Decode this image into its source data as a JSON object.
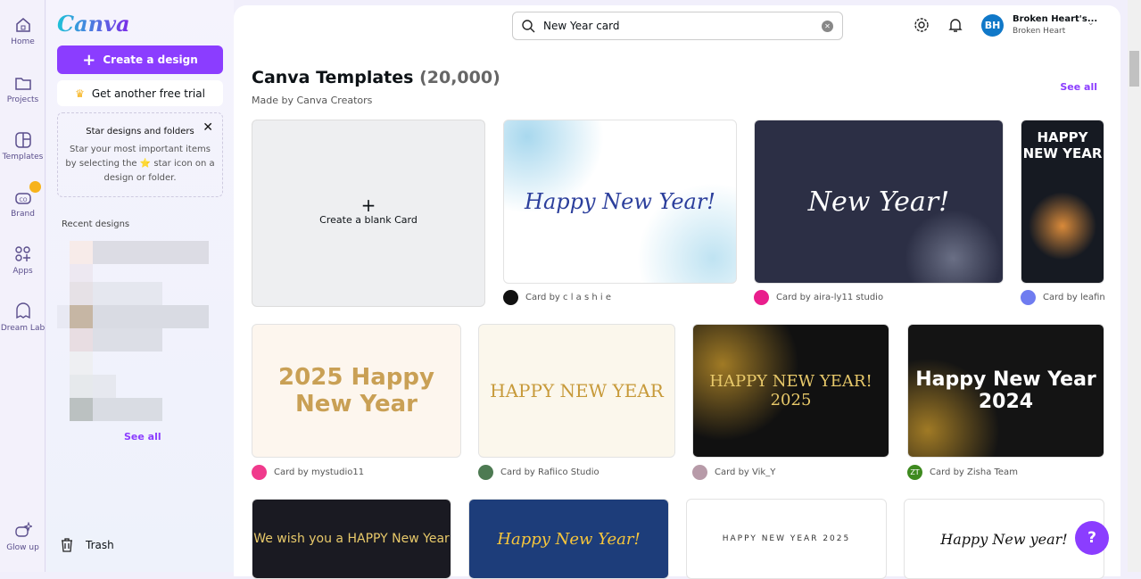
{
  "rail": [
    {
      "label": "Home",
      "icon": "home-icon"
    },
    {
      "label": "Projects",
      "icon": "folder-icon"
    },
    {
      "label": "Templates",
      "icon": "templates-icon"
    },
    {
      "label": "Brand",
      "icon": "brand-icon"
    },
    {
      "label": "Apps",
      "icon": "apps-icon"
    },
    {
      "label": "Dream Lab",
      "icon": "dream-lab-icon"
    },
    {
      "label": "Glow up",
      "icon": "glow-up-icon"
    }
  ],
  "sidebar": {
    "logo": "Canva",
    "create": "Create a design",
    "trial": "Get another free trial",
    "tip_title": "Star designs and folders",
    "tip_body": "Star your most important items by selecting the ⭐ star icon on a design or folder.",
    "recent": "Recent designs",
    "see_all": "See all",
    "trash": "Trash"
  },
  "header": {
    "search_value": "New Year card",
    "user_name": "Broken Heart's...",
    "user_sub": "Broken Heart",
    "avatar": "BH"
  },
  "main": {
    "title": "Canva Templates",
    "count": "(20,000)",
    "subtitle": "Made by Canva Creators",
    "see_all": "See all",
    "blank": "Create a blank Card",
    "cards": [
      {
        "thumb": "Happy New Year!",
        "by": "Card by c l a s h i e",
        "color": "#111"
      },
      {
        "thumb": "New Year!",
        "by": "Card by aira-ly11 studio",
        "color": "#e91e8c"
      },
      {
        "thumb": "HAPPY NEW YEAR",
        "by": "Card by leafin",
        "color": "#6f7cf0"
      },
      {
        "thumb": "2025 Happy New Year",
        "by": "Card by mystudio11",
        "color": "#f03a8c"
      },
      {
        "thumb": "HAPPY NEW YEAR",
        "by": "Card by Rafiico Studio",
        "color": "#4d7a52"
      },
      {
        "thumb": "HAPPY NEW YEAR! 2025",
        "by": "Card by Vik_Y",
        "color": "#b79aa8"
      },
      {
        "thumb": "Happy New Year 2024",
        "by": "Card by Zisha Team",
        "color": "#3e8a1f",
        "initials": "ZT"
      },
      {
        "thumb": "We wish you a HAPPY New Year"
      },
      {
        "thumb": "Happy New Year!"
      },
      {
        "thumb": "HAPPY NEW YEAR 2025"
      },
      {
        "thumb": "Happy New year!"
      }
    ]
  },
  "help": "?",
  "colors": {
    "accent": "#8b3dff",
    "avatar": "#1078c8"
  }
}
